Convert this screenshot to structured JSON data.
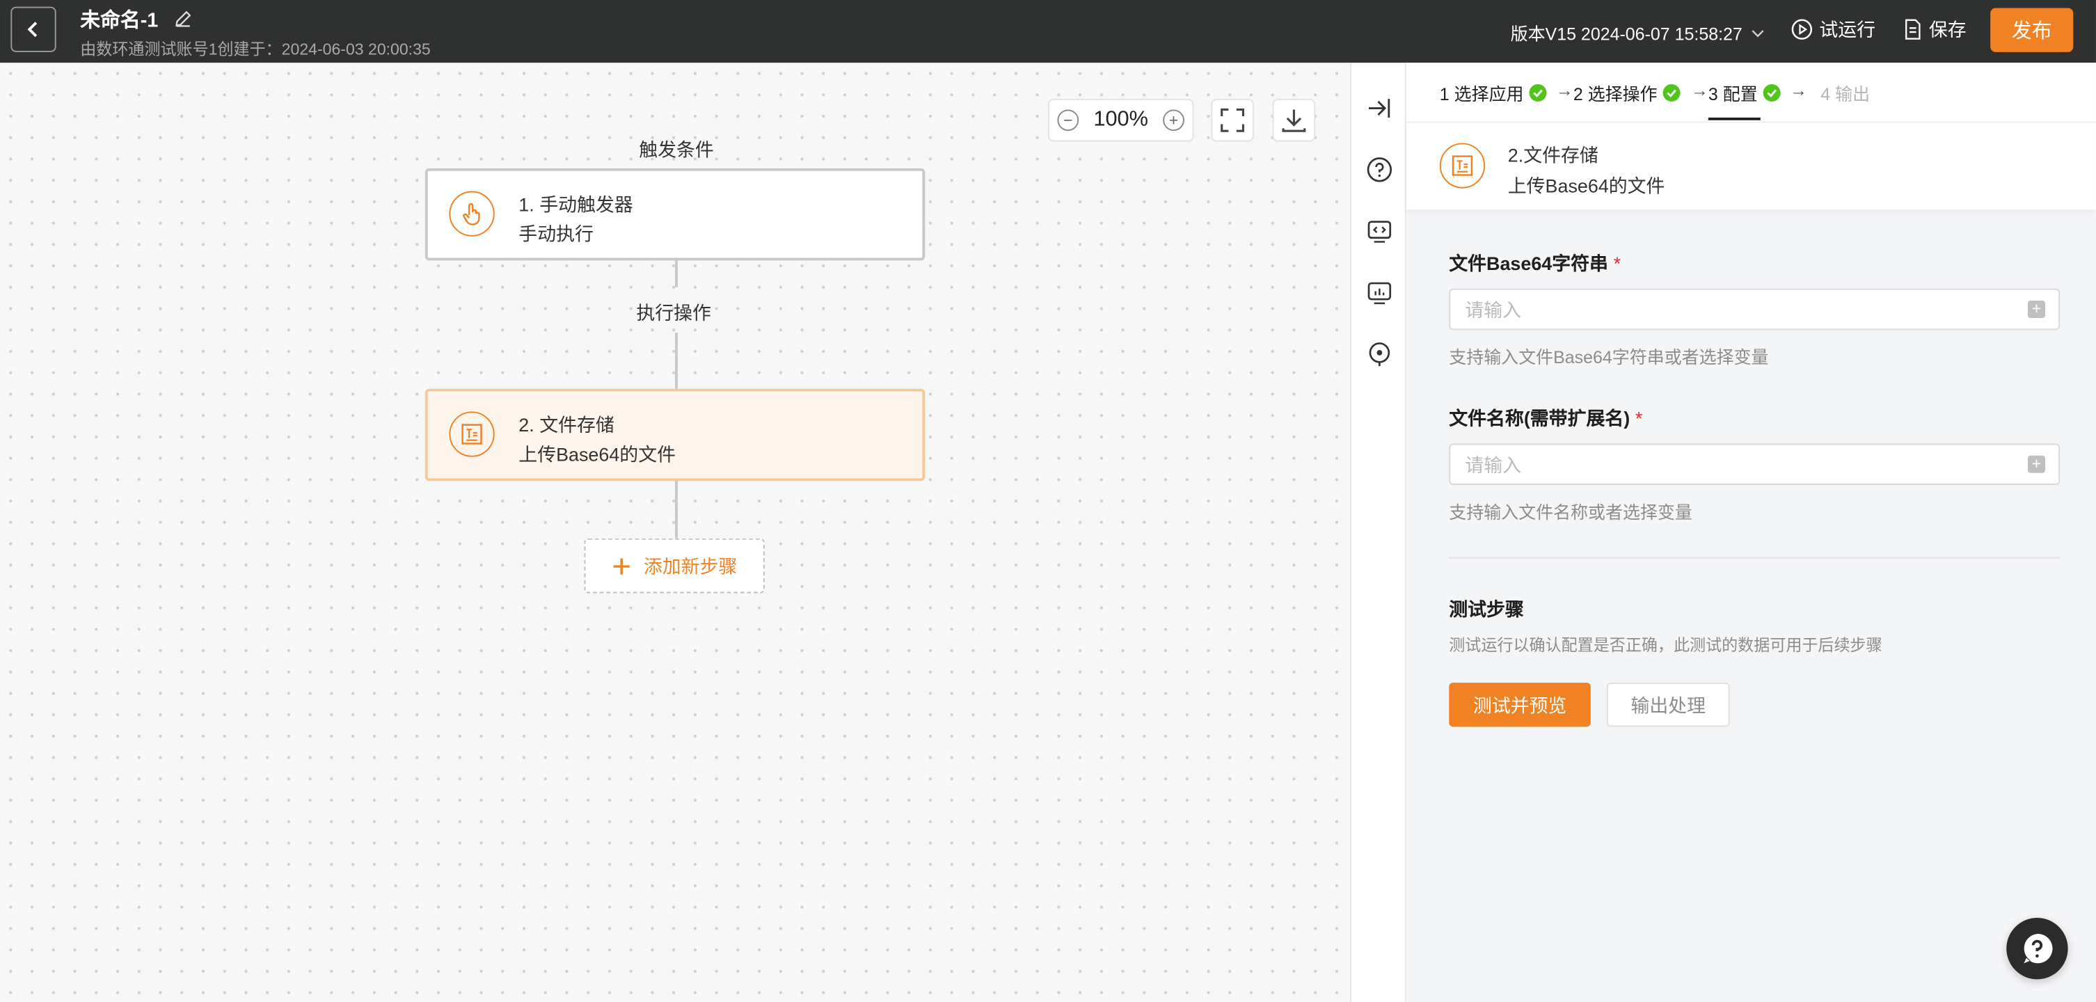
{
  "header": {
    "title": "未命名-1",
    "subtitle": "由数环通测试账号1创建于：2024-06-03 20:00:35",
    "version": "版本V15 2024-06-07 15:58:27",
    "trial_run": "试运行",
    "save": "保存",
    "publish": "发布",
    "accent": "#f08224"
  },
  "canvas": {
    "zoom": "100%",
    "trigger_label": "触发条件",
    "action_label": "执行操作",
    "nodes": [
      {
        "title": "1. 手动触发器",
        "subtitle": "手动执行"
      },
      {
        "title": "2. 文件存储",
        "subtitle": "上传Base64的文件"
      }
    ],
    "add_step": "添加新步骤"
  },
  "panel": {
    "steps": [
      {
        "label": "1 选择应用"
      },
      {
        "label": "2 选择操作"
      },
      {
        "label": "3 配置"
      },
      {
        "label": "4 输出"
      }
    ],
    "app": {
      "title": "2.文件存储",
      "subtitle": "上传Base64的文件"
    },
    "fields": [
      {
        "label": "文件Base64字符串",
        "required": "*",
        "placeholder": "请输入",
        "hint": "支持输入文件Base64字符串或者选择变量"
      },
      {
        "label": "文件名称(需带扩展名)",
        "required": "*",
        "placeholder": "请输入",
        "hint": "支持输入文件名称或者选择变量"
      }
    ],
    "test": {
      "title": "测试步骤",
      "desc": "测试运行以确认配置是否正确，此测试的数据可用于后续步骤",
      "primary": "测试并预览",
      "secondary": "输出处理"
    }
  }
}
